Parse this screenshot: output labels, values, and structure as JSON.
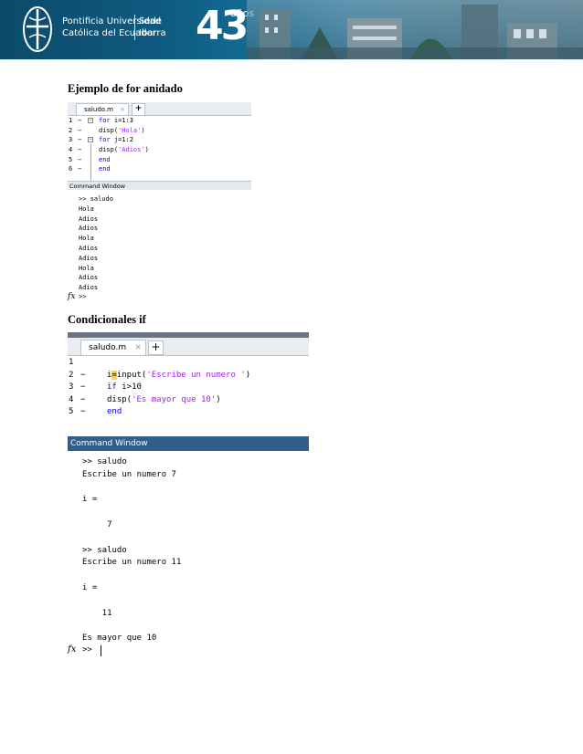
{
  "header": {
    "university_line1": "Pontificia Universidad",
    "university_line2": "Católica del Ecuador",
    "sede_line1": "Sede",
    "sede_line2": "Ibarra",
    "anniversary_number": "43",
    "anniversary_word": "años",
    "brand_color": "#0f5b80"
  },
  "section1": {
    "heading": "Ejemplo de for anidado",
    "editor": {
      "tab_label": "saludo.m",
      "tab_close": "×",
      "add_tab": "+",
      "lines": [
        {
          "num": "1",
          "dash": "−",
          "code": [
            "for",
            " i=1:3"
          ]
        },
        {
          "num": "2",
          "dash": "−",
          "code": [
            "disp(",
            "'Hola'",
            ")"
          ]
        },
        {
          "num": "3",
          "dash": "−",
          "code": [
            "for",
            " j=1:2"
          ]
        },
        {
          "num": "4",
          "dash": "−",
          "code": [
            "disp(",
            "'Adios'",
            ")"
          ]
        },
        {
          "num": "5",
          "dash": "−",
          "code": [
            "end"
          ]
        },
        {
          "num": "6",
          "dash": "−",
          "code": [
            "end"
          ]
        }
      ]
    },
    "command_window": {
      "title": "Command Window",
      "output": ">> saludo\nHola\nAdios\nAdios\nHola\nAdios\nAdios\nHola\nAdios\nAdios",
      "fx": "fx",
      "prompt": ">>"
    }
  },
  "section2": {
    "heading": "Condicionales if",
    "editor": {
      "tab_label": "saludo.m",
      "tab_close": "×",
      "add_tab": "+",
      "lines": [
        {
          "num": "1",
          "dash": ""
        },
        {
          "num": "2",
          "dash": "−",
          "pre": "i",
          "cursor": "=",
          "fn": "input(",
          "str": "'Escribe un numero '",
          "post": ")"
        },
        {
          "num": "3",
          "dash": "−",
          "kw": "if",
          "rest": " i>10"
        },
        {
          "num": "4",
          "dash": "−",
          "fn": "disp(",
          "str": "'Es mayor que 10'",
          "post": ")"
        },
        {
          "num": "5",
          "dash": "−",
          "kw": "end"
        }
      ]
    },
    "command_window": {
      "title": "Command Window",
      "output": ">> saludo\nEscribe un numero 7\n\ni =\n\n     7\n\n>> saludo\nEscribe un numero 11\n\ni =\n\n    11\n\nEs mayor que 10",
      "fx": "fx",
      "prompt": ">>"
    }
  }
}
